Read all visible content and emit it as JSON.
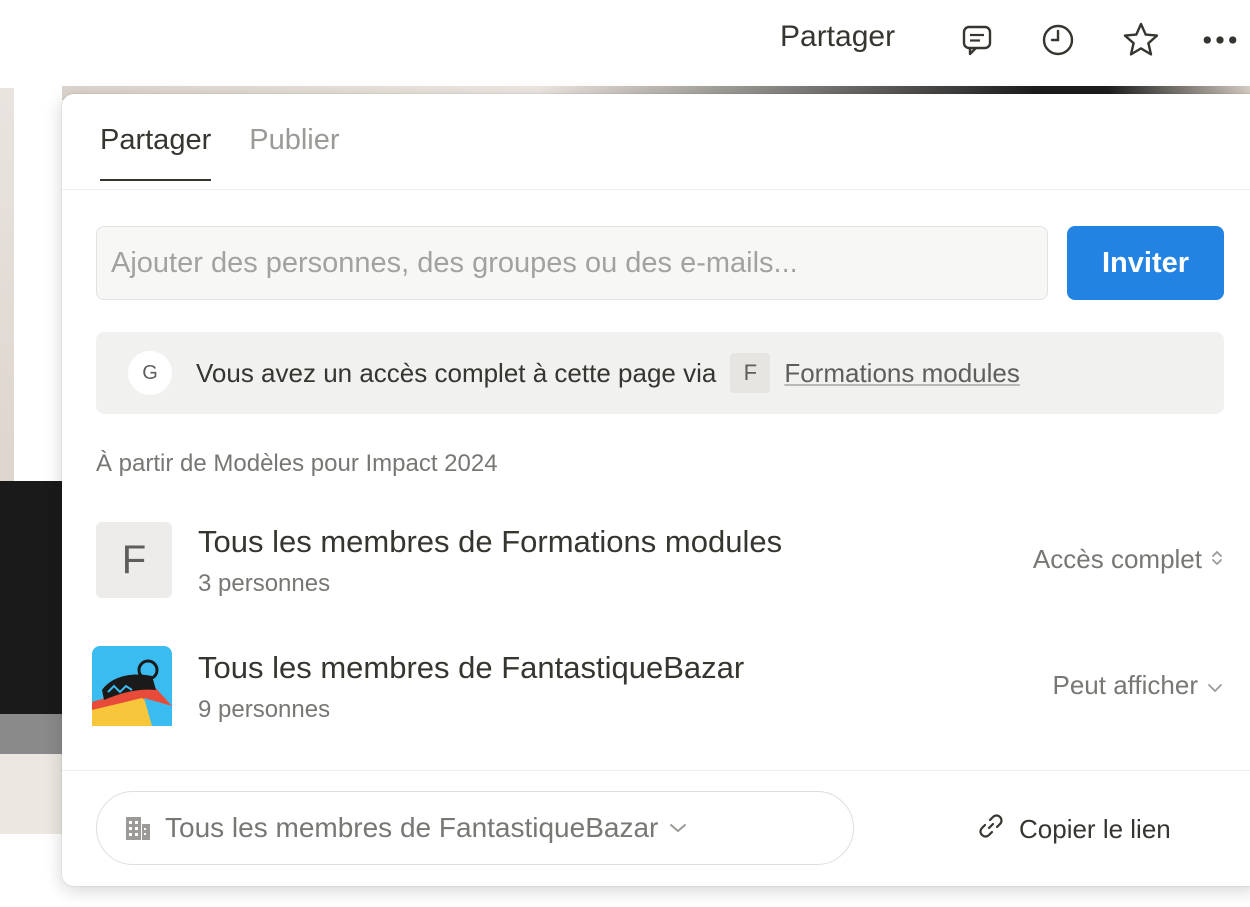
{
  "topbar": {
    "share_label": "Partager",
    "icons": [
      "comment-icon",
      "clock-icon",
      "star-icon",
      "more-icon"
    ]
  },
  "share_popup": {
    "tabs": [
      {
        "label": "Partager",
        "active": true
      },
      {
        "label": "Publier",
        "active": false
      }
    ],
    "invite": {
      "placeholder": "Ajouter des personnes, des groupes ou des e-mails...",
      "value": "",
      "button_label": "Inviter"
    },
    "access_banner": {
      "avatar_letter": "G",
      "text": "Vous avez un accès complet à cette page via",
      "workspace_letter": "F",
      "workspace_name": "Formations modules"
    },
    "section_label": "À partir de Modèles pour Impact 2024",
    "members": [
      {
        "avatar_letter": "F",
        "title": "Tous les membres de Formations modules",
        "subtitle": "3 personnes",
        "permission": "Accès complet"
      },
      {
        "avatar_icon": "fantastiquebazar-logo-icon",
        "title": "Tous les membres de FantastiqueBazar",
        "subtitle": "9 personnes",
        "permission": "Peut afficher"
      }
    ],
    "footer": {
      "scope_label": "Tous les membres de FantastiqueBazar",
      "copy_link_label": "Copier le lien"
    }
  },
  "colors": {
    "accent": "#2383e2",
    "text": "#37352f",
    "muted": "#787774",
    "banner_bg": "#f1f1ef"
  }
}
